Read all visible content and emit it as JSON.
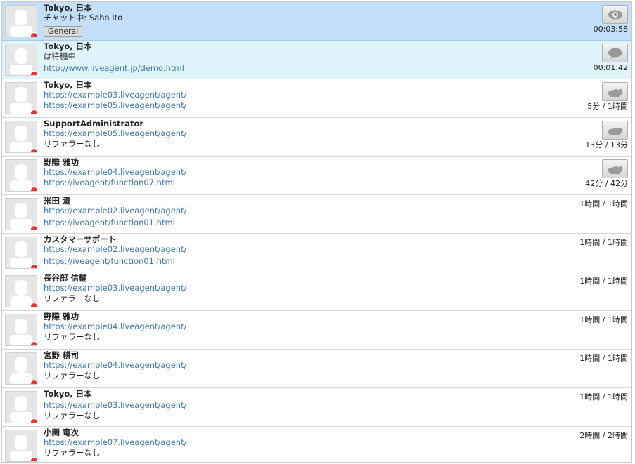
{
  "colors": {
    "active_row": "#c3dff9",
    "waiting_row": "#e0f4fb",
    "link": "#3d77a8",
    "status_offline": "#ee3333"
  },
  "rows": [
    {
      "name": "Tokyo, 日本",
      "line1": "チャット中: Saho Ito",
      "line1_type": "text",
      "tag": "General",
      "time": "00:03:58",
      "action": "eye-icon",
      "state": "active"
    },
    {
      "name": "Tokyo, 日本",
      "line1": "は待機中",
      "line1_type": "text",
      "line2": "http://www.liveagent.jp/demo.html",
      "line2_type": "link",
      "time": "00:01:42",
      "action": "chat-bubble-icon",
      "state": "waiting"
    },
    {
      "name": "Tokyo, 日本",
      "line1": "https://example03.liveagent/agent/",
      "line1_type": "link",
      "line2": "https://example05.liveagent/agent/",
      "line2_type": "link",
      "time": "5分 / 1時間",
      "action": "hand-icon"
    },
    {
      "name": "SupportAdministrator",
      "line1": "https://example05.liveagent/agent/",
      "line1_type": "link",
      "line2": "リファラーなし",
      "line2_type": "text",
      "time": "13分 / 13分",
      "action": "hand-icon"
    },
    {
      "name": "野際 雅功",
      "line1": "https://example04.liveagent/agent/",
      "line1_type": "link",
      "line2": "https://iveagent/function07.html",
      "line2_type": "link",
      "time": "42分 / 42分",
      "action": "hand-icon"
    },
    {
      "name": "米田 満",
      "line1": "https://example02.liveagent/agent/",
      "line1_type": "link",
      "line2": "https://iveagent/function01.html",
      "line2_type": "link",
      "time": "1時間 / 1時間"
    },
    {
      "name": "カスタマーサポート",
      "line1": "https://example02.liveagent/agent/",
      "line1_type": "link",
      "line2": "https://iveagent/function01.html",
      "line2_type": "link",
      "time": "1時間 / 1時間"
    },
    {
      "name": "長谷部 信輔",
      "line1": "https://example03.liveagent/agent/",
      "line1_type": "link",
      "line2": "リファラーなし",
      "line2_type": "text",
      "time": "1時間 / 1時間"
    },
    {
      "name": "野際 雅功",
      "line1": "https://example04.liveagent/agent/",
      "line1_type": "link",
      "line2": "リファラーなし",
      "line2_type": "text",
      "time": "1時間 / 1時間"
    },
    {
      "name": "宮野 耕司",
      "line1": "https://example04.liveagent/agent/",
      "line1_type": "link",
      "line2": "リファラーなし",
      "line2_type": "text",
      "time": "1時間 / 1時間"
    },
    {
      "name": "Tokyo, 日本",
      "line1": "https://example03.liveagent/agent/",
      "line1_type": "link",
      "line2": "リファラーなし",
      "line2_type": "text",
      "time": "1時間 / 1時間"
    },
    {
      "name": "小関 竜次",
      "line1": "https://example07.liveagent/agent/",
      "line1_type": "link",
      "line2": "リファラーなし",
      "line2_type": "text",
      "time": "2時間 / 2時間"
    }
  ]
}
